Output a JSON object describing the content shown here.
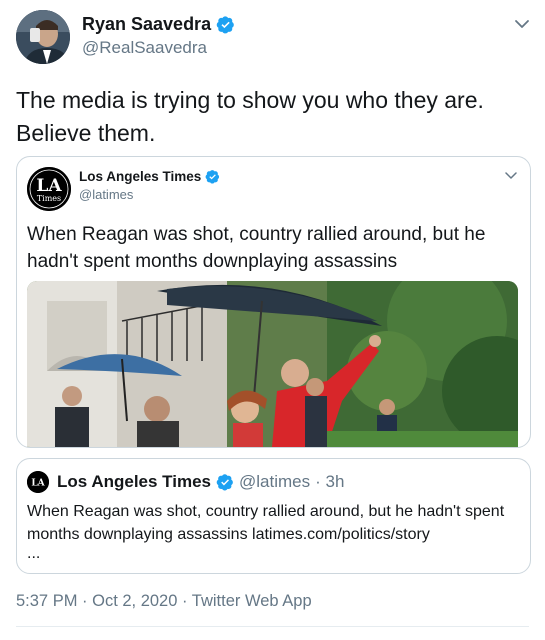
{
  "tweet": {
    "author_name": "Ryan Saavedra",
    "author_handle": "@RealSaavedra",
    "text": "The media is trying to show you who they are. Believe them.",
    "timestamp": "5:37 PM · Oct 2, 2020 · Twitter Web App"
  },
  "quoted": {
    "name": "Los Angeles Times",
    "handle": "@latimes",
    "text": "When Reagan was shot, country rallied around, but he hadn't spent months downplaying assassins",
    "logo_text_top": "LA",
    "logo_text_bottom": "Times"
  },
  "link_card": {
    "name": "Los Angeles Times",
    "handle": "@latimes",
    "time": "· 3h",
    "text": "When Reagan was shot, country rallied around, but he hadn't spent months downplaying assassins latimes.com/politics/story",
    "more": "...",
    "logo_text": "LA"
  },
  "icons": {
    "verified": "verified-badge-icon",
    "menu": "chevron-down-icon"
  },
  "colors": {
    "verified_blue": "#1da1f2",
    "secondary_text": "#657786",
    "border": "#ccd6dd"
  }
}
